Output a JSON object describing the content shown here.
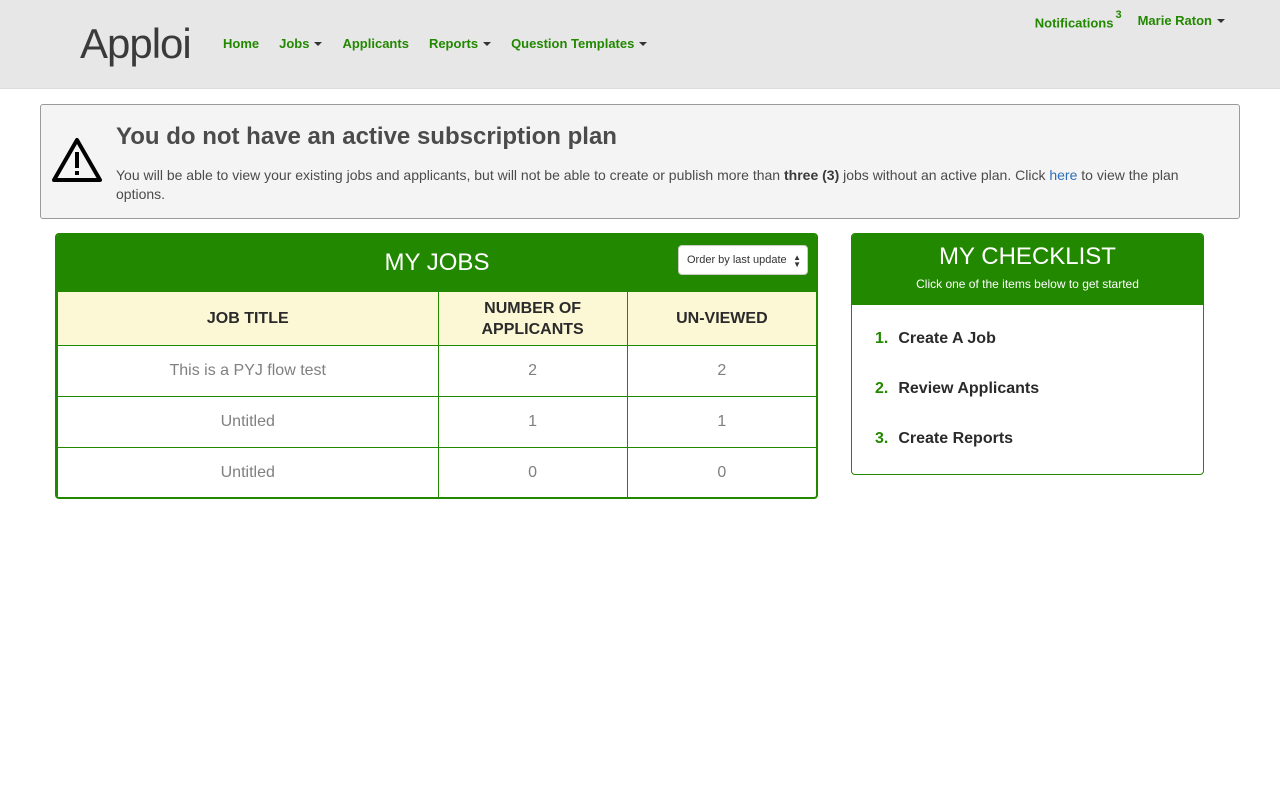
{
  "nav": {
    "logo": "Apploi",
    "links": [
      {
        "label": "Home",
        "dropdown": false
      },
      {
        "label": "Jobs",
        "dropdown": true
      },
      {
        "label": "Applicants",
        "dropdown": false
      },
      {
        "label": "Reports",
        "dropdown": true
      },
      {
        "label": "Question Templates",
        "dropdown": true
      }
    ],
    "notifications_label": "Notifications",
    "notifications_count": "3",
    "user_name": "Marie Raton"
  },
  "alert": {
    "title": "You do not have an active subscription plan",
    "body_before": "You will be able to view your existing jobs and applicants, but will not be able to create or publish more than ",
    "body_bold": "three (3)",
    "body_middle": " jobs without an active plan. Click ",
    "link_text": "here",
    "body_after": " to view the plan options."
  },
  "jobs": {
    "title": "MY JOBS",
    "order_select_value": "Order by last update",
    "columns": [
      "JOB TITLE",
      "NUMBER OF APPLICANTS",
      "UN-VIEWED"
    ],
    "rows": [
      {
        "title": "This is a PYJ flow test",
        "applicants": "2",
        "unviewed": "2"
      },
      {
        "title": "Untitled",
        "applicants": "1",
        "unviewed": "1"
      },
      {
        "title": "Untitled",
        "applicants": "0",
        "unviewed": "0"
      }
    ]
  },
  "checklist": {
    "title": "MY CHECKLIST",
    "subtitle": "Click one of the items below to get started",
    "items": [
      {
        "num": "1.",
        "label": "Create A Job"
      },
      {
        "num": "2.",
        "label": "Review Applicants"
      },
      {
        "num": "3.",
        "label": "Create Reports"
      }
    ]
  },
  "colors": {
    "brand_green": "#228800",
    "header_yellow": "#fcf7d4",
    "navbar_gray": "#e7e7e7",
    "link_blue": "#2e6fb8"
  }
}
